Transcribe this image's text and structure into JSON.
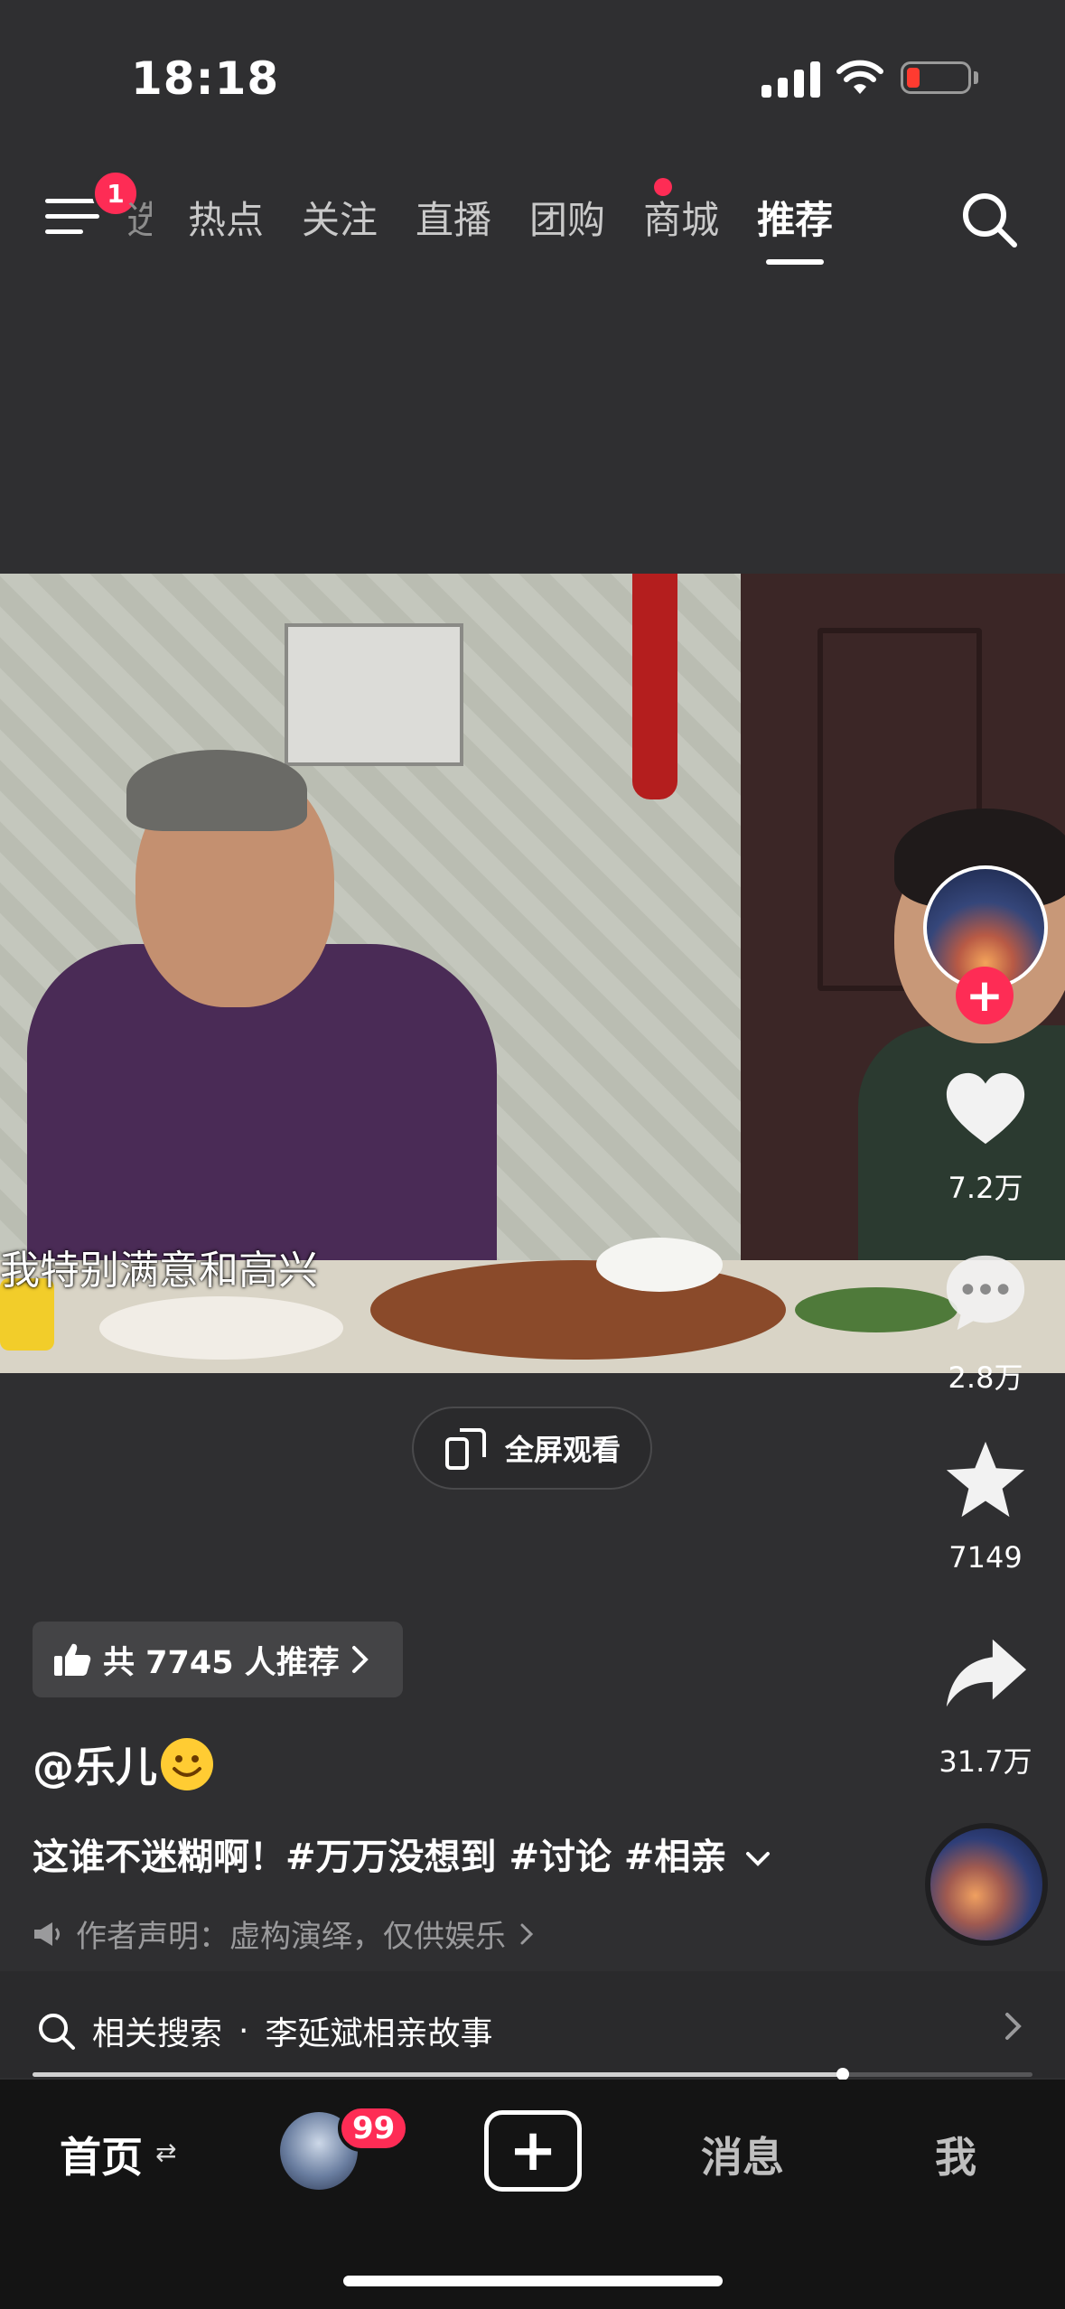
{
  "status_bar": {
    "time": "18:18"
  },
  "top_tabs": {
    "menu_badge": "1",
    "items": [
      "选",
      "热点",
      "关注",
      "直播",
      "团购",
      "商城",
      "推荐"
    ],
    "active": "推荐"
  },
  "video": {
    "subtitle": "我特别满意和高兴"
  },
  "fullscreen_button": {
    "label": "全屏观看"
  },
  "right_rail": {
    "like_count": "7.2万",
    "comment_count": "2.8万",
    "favorite_count": "7149",
    "share_count": "31.7万"
  },
  "info": {
    "recommend_chip": "共 7745 人推荐",
    "username": "@乐儿",
    "caption": "这谁不迷糊啊！#万万没想到 #讨论 #相亲",
    "declaration": "作者声明：虚构演绎，仅供娱乐"
  },
  "related_search": {
    "prefix": "相关搜索",
    "separator": "·",
    "query": "李延斌相亲故事"
  },
  "progress": {
    "fraction": 0.81
  },
  "bottom_nav": {
    "home": "首页",
    "friends_badge": "99",
    "messages": "消息",
    "me": "我"
  },
  "colors": {
    "accent": "#fe2c55",
    "background": "#2f2f31",
    "nav_background": "#141414"
  }
}
